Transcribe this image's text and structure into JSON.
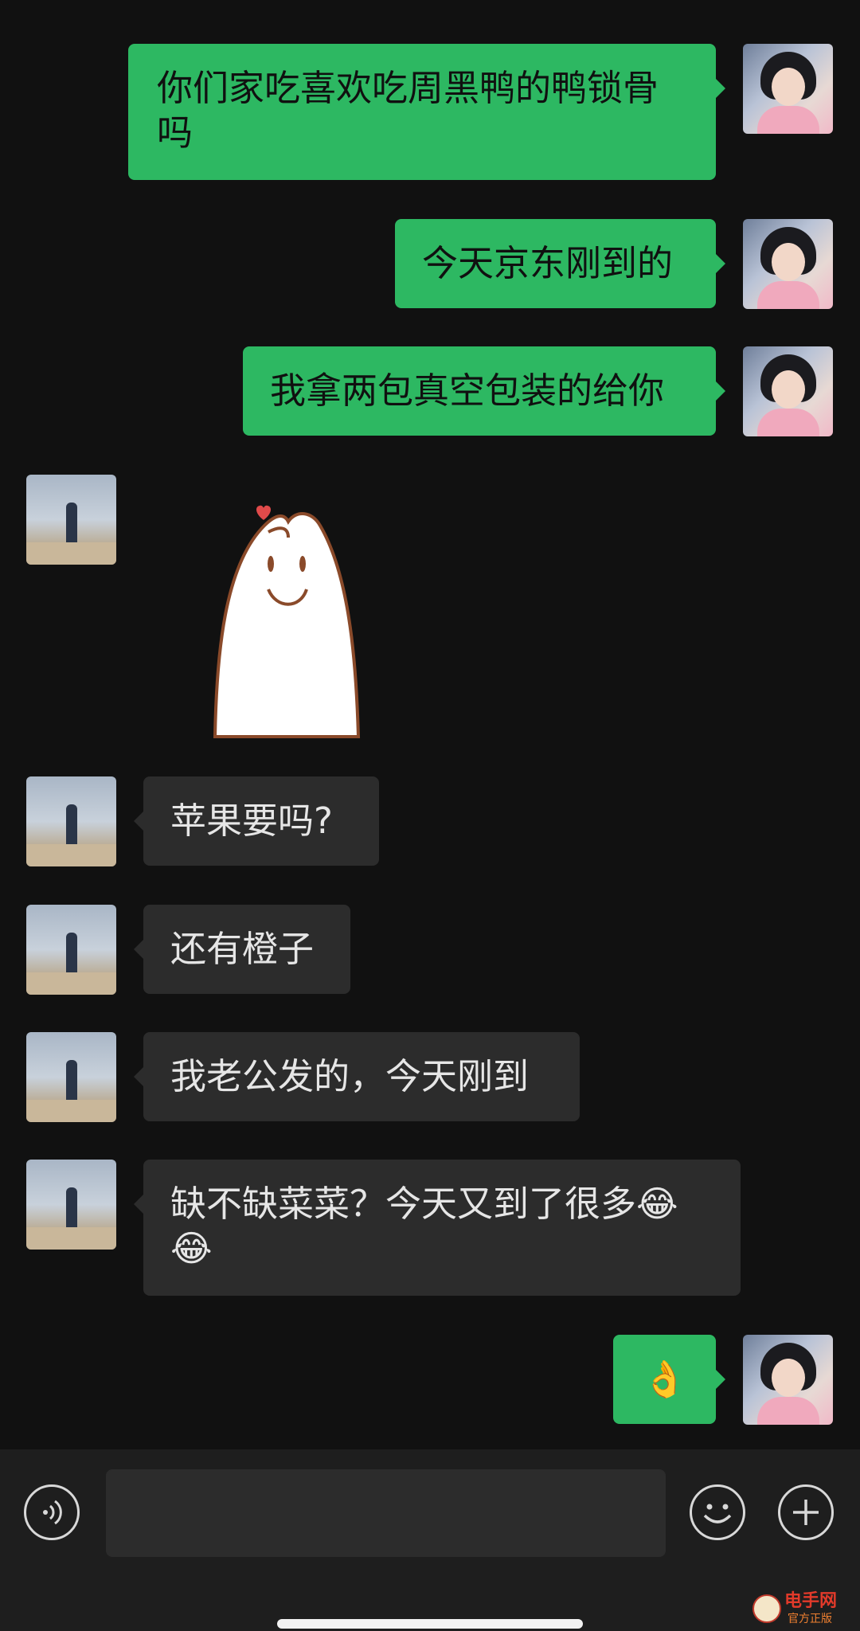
{
  "messages": [
    {
      "side": "out",
      "text": "你们家吃喜欢吃周黑鸭的鸭锁骨吗"
    },
    {
      "side": "out",
      "text": "今天京东刚到的"
    },
    {
      "side": "out",
      "text": "我拿两包真空包装的给你"
    },
    {
      "side": "in",
      "type": "sticker",
      "text": ""
    },
    {
      "side": "in",
      "text": "苹果要吗?"
    },
    {
      "side": "in",
      "text": "还有橙子"
    },
    {
      "side": "in",
      "text": "我老公发的，今天刚到"
    },
    {
      "side": "in",
      "text": "缺不缺菜菜？今天又到了很多😂😂"
    },
    {
      "side": "out",
      "text": "👌"
    }
  ],
  "input_bar": {
    "voice_icon": "voice-icon",
    "emoji_icon": "emoji-icon",
    "plus_icon": "plus-icon",
    "input_value": ""
  },
  "watermark": {
    "title": "电手网",
    "subtitle": "官方正版"
  },
  "colors": {
    "background": "#111111",
    "outgoing_bubble": "#2db862",
    "incoming_bubble": "#2c2c2c",
    "input_bar": "#1e1e1e"
  }
}
